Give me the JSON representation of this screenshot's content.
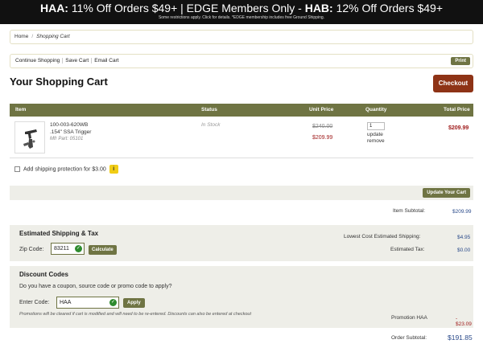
{
  "banner": {
    "haa_label": "HAA:",
    "haa_text": "11% Off Orders $49+",
    "edge_text": "EDGE Members Only -",
    "hab_label": "HAB:",
    "hab_text": "12% Off Orders $49+",
    "sub_text": "Some restrictions apply. Click for details. *EDGE membership includes free Ground Shipping."
  },
  "breadcrumb": {
    "home": "Home",
    "current": "Shopping Cart"
  },
  "cart_actions": {
    "continue": "Continue Shopping",
    "save": "Save Cart",
    "email": "Email Cart",
    "print": "Print"
  },
  "page": {
    "title": "Your Shopping Cart",
    "checkout": "Checkout"
  },
  "table": {
    "headers": {
      "item": "Item",
      "status": "Status",
      "unit_price": "Unit Price",
      "quantity": "Quantity",
      "total_price": "Total Price"
    },
    "row": {
      "sku": "100-003-620WB",
      "name": ".154\" SSA Trigger",
      "mfr_part": "Mfr Part: 05101",
      "status": "In Stock",
      "old_price": "$240.00",
      "price": "$209.99",
      "qty": "1",
      "update": "update",
      "remove": "remove",
      "total": "$209.99"
    }
  },
  "shipping_protection": {
    "label": "Add shipping protection for $3.00",
    "info": "i"
  },
  "update_cart": "Update Your Cart",
  "subtotal": {
    "label": "Item Subtotal:",
    "value": "$209.99"
  },
  "shipping": {
    "title": "Estimated Shipping & Tax",
    "zip_label": "Zip Code:",
    "zip_value": "83211",
    "calculate": "Calculate",
    "lowest_label": "Lowest Cost Estimated Shipping:",
    "lowest_value": "$4.95",
    "tax_label": "Estimated Tax:",
    "tax_value": "$0.00"
  },
  "discount": {
    "title": "Discount Codes",
    "question": "Do you have a coupon, source code or promo code to apply?",
    "code_label": "Enter Code:",
    "code_value": "HAA",
    "apply": "Apply",
    "note": "Promotions will be cleared if cart is modified and will need to be re-entered. Discounts can also be entered at checkout",
    "promo_label": "Promotion HAA",
    "promo_value": "- $23.09"
  },
  "order": {
    "label": "Order Subtotal:",
    "value": "$191.85"
  }
}
